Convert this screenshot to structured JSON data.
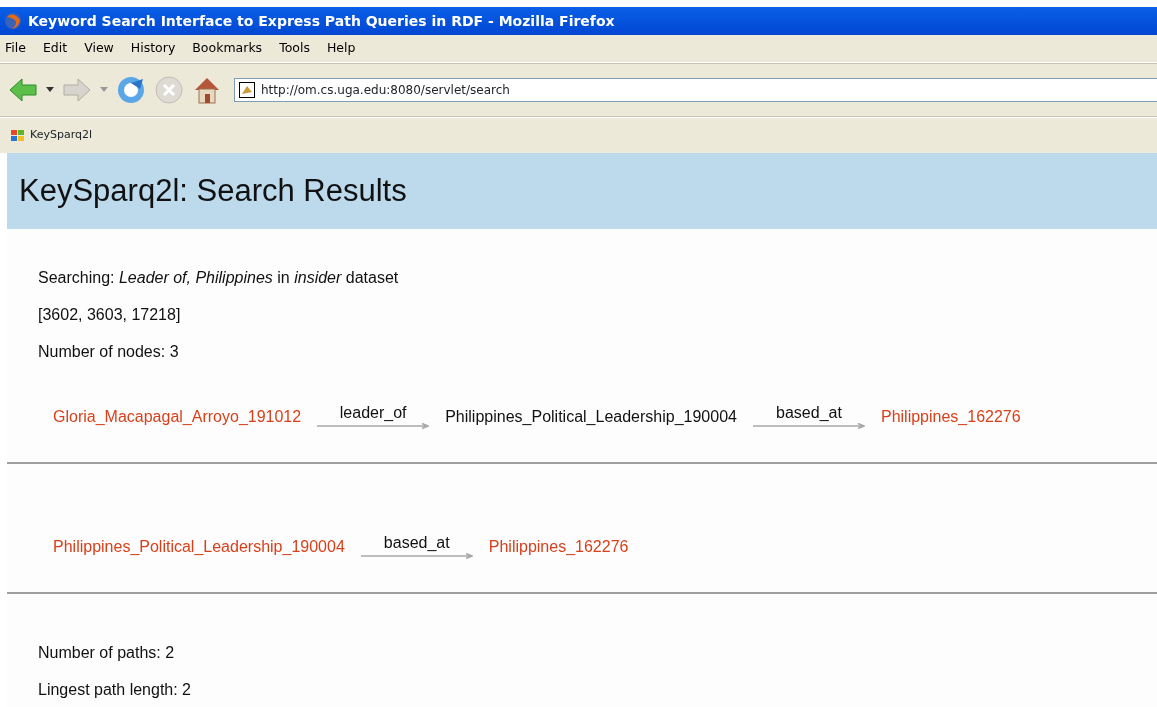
{
  "window": {
    "title": "Keyword Search Interface to Express Path Queries in RDF - Mozilla Firefox"
  },
  "menu": [
    "File",
    "Edit",
    "View",
    "History",
    "Bookmarks",
    "Tools",
    "Help"
  ],
  "address": {
    "value": "http://om.cs.uga.edu:8080/servlet/search"
  },
  "bookmarks": [
    "KeySparq2l"
  ],
  "page": {
    "heading": "KeySparq2l: Search Results",
    "searching": "Searching: *Leader of, Philippines* in *insider* dataset",
    "ids": "[3602, 3603, 17218]",
    "nodes_count": "Number of nodes: 3",
    "paths": [
      {
        "nodes": [
          {
            "label": "Gloria_Macapagal_Arroyo_191012",
            "highlighted": true
          },
          {
            "label": "Philippines_Political_Leadership_190004",
            "highlighted": false
          },
          {
            "label": "Philippines_162276",
            "highlighted": true
          }
        ],
        "edges": [
          "leader_of",
          "based_at"
        ]
      },
      {
        "nodes": [
          {
            "label": "Philippines_Political_Leadership_190004",
            "highlighted": true
          },
          {
            "label": "Philippines_162276",
            "highlighted": true
          }
        ],
        "edges": [
          "based_at"
        ]
      }
    ],
    "paths_count": "Number of paths: 2",
    "longest": "Lingest path length: 2"
  }
}
